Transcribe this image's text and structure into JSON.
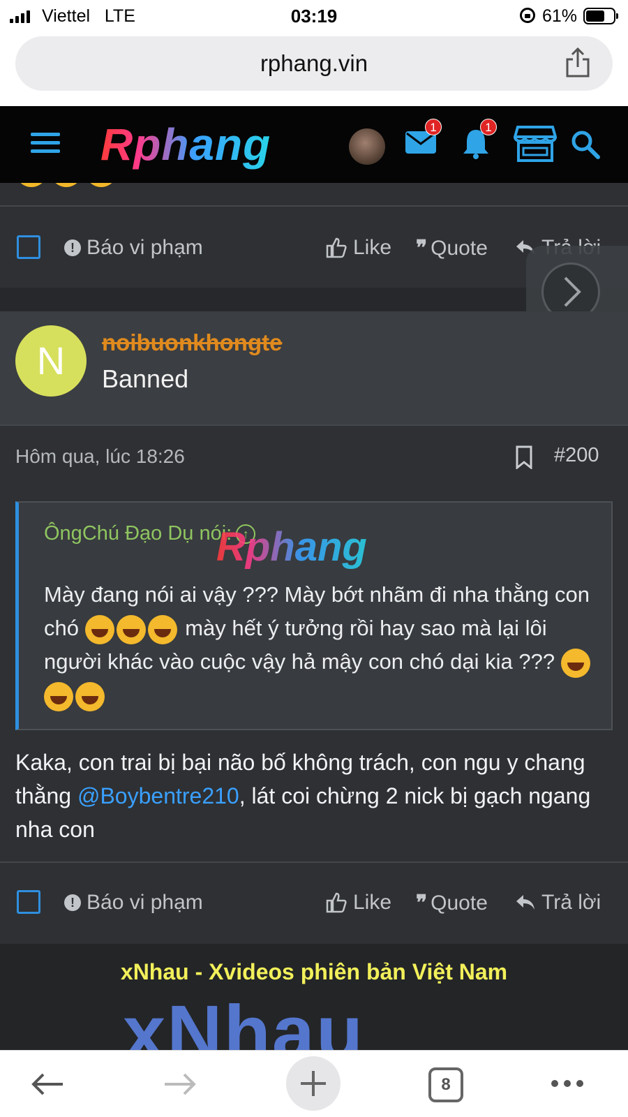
{
  "status_bar": {
    "carrier": "Viettel",
    "network": "LTE",
    "time": "03:19",
    "battery_percent": "61%",
    "battery_level": 0.61
  },
  "browser": {
    "url": "rphang.vin",
    "open_tabs": "8"
  },
  "site_header": {
    "logo_text": "Rphang",
    "mail_badge": "1",
    "notifications_badge": "1"
  },
  "post_actions": {
    "report_label": "Báo vi phạm",
    "like_label": "Like",
    "quote_label": "Quote",
    "reply_label": "Trả lời"
  },
  "post": {
    "username": "noibuonkhongte",
    "user_title": "Banned",
    "avatar_letter": "N",
    "date": "Hôm qua, lúc 18:26",
    "post_number": "#200",
    "quote_author": "ÔngChú Đạo Dụ nói:",
    "quote_text_1": "Mày đang nói ai vậy ??? Mày bớt nhãm đi nha thằng con chó",
    "quote_text_2": "mày hết ý tưởng rồi hay sao mà lại lôi người khác vào cuộc vậy hả mậy con chó dại kia ???",
    "body_text_1": "Kaka, con trai bị bại não bố không trách, con ngu y chang thằng ",
    "body_mention": "@Boybentre210",
    "body_text_2": ", lát coi chừng 2 nick bị gạch ngang nha con",
    "watermark": "Rphang"
  },
  "ad": {
    "title": "xNhau - Xvideos phiên bản Việt Nam",
    "logo_text": "xNhau"
  },
  "colors": {
    "accent_blue": "#2f8fe0",
    "username_orange": "#e08a1e",
    "quote_author_green": "#8fc560",
    "ad_title_yellow": "#f2f05a"
  }
}
